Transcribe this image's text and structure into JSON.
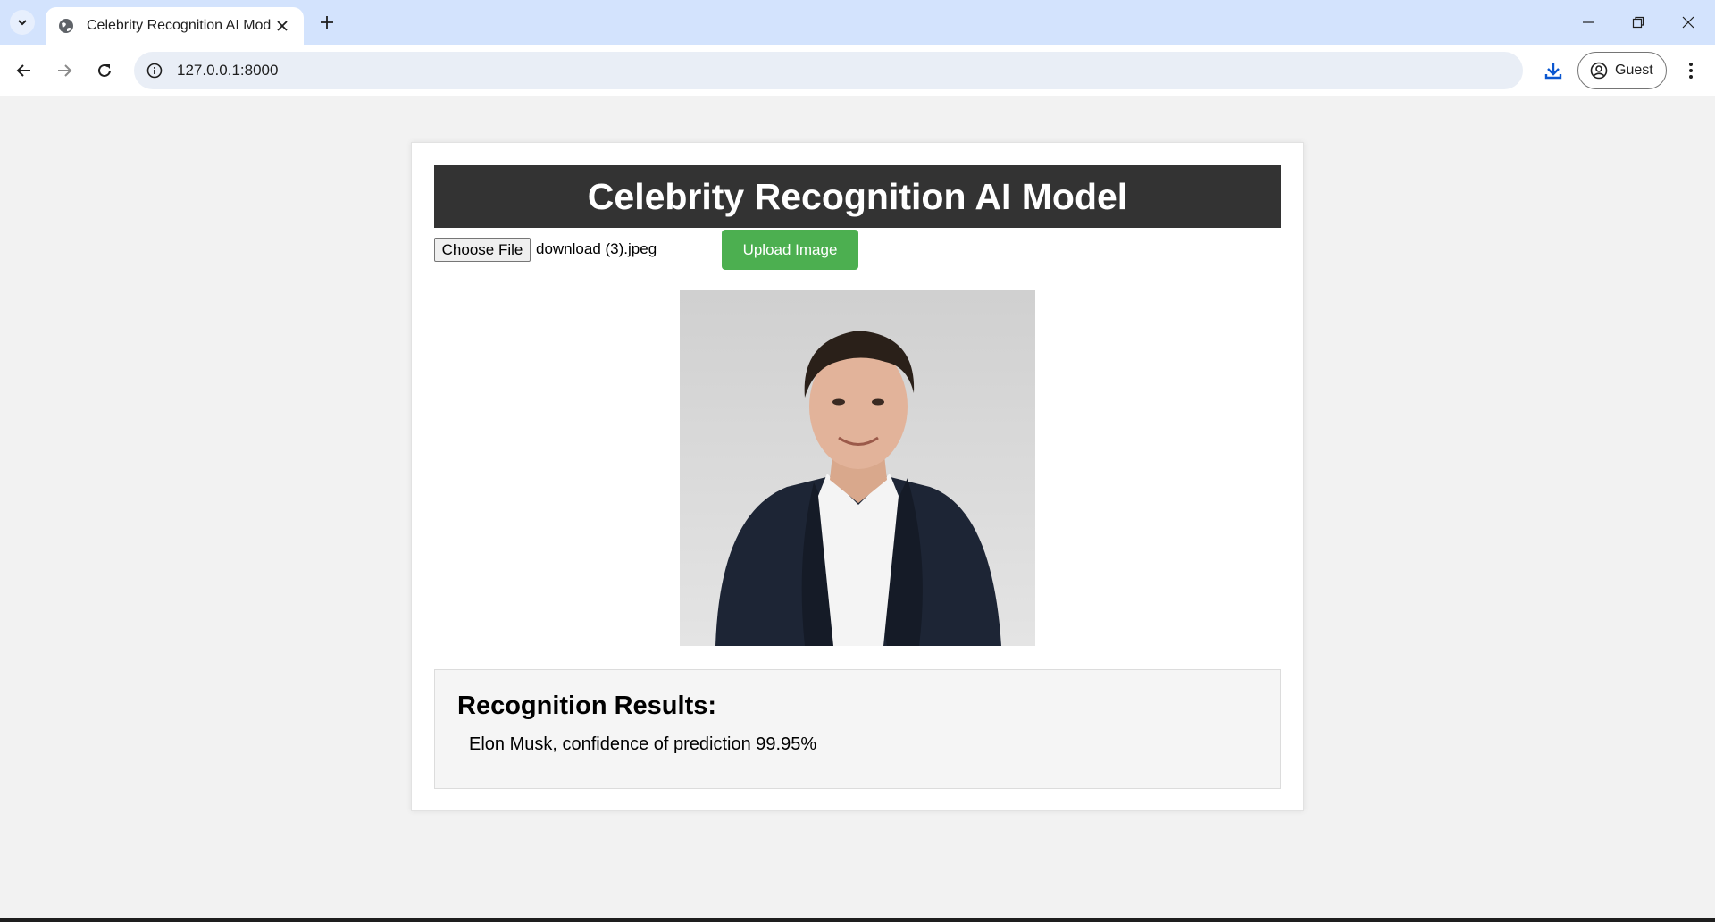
{
  "browser": {
    "tab_title": "Celebrity Recognition AI Model",
    "url": "127.0.0.1:8000",
    "profile_label": "Guest"
  },
  "page": {
    "title": "Celebrity Recognition AI Model",
    "choose_file_label": "Choose File",
    "file_name": "download (3).jpeg",
    "upload_label": "Upload Image",
    "results_heading": "Recognition Results:",
    "results": [
      "Elon Musk, confidence of prediction 99.95%"
    ]
  },
  "icons": {
    "tab_search": "chevron-down-icon",
    "favicon": "globe-icon",
    "tab_close": "close-icon",
    "new_tab": "plus-icon",
    "back": "arrow-left-icon",
    "forward": "arrow-right-icon",
    "reload": "reload-icon",
    "site_info": "info-icon",
    "download": "download-icon",
    "profile": "account-icon",
    "menu": "kebab-menu-icon"
  },
  "colors": {
    "tabstrip": "#d3e3fd",
    "header_bg": "#333333",
    "upload_button": "#4caf50",
    "page_bg": "#f2f2f2"
  }
}
